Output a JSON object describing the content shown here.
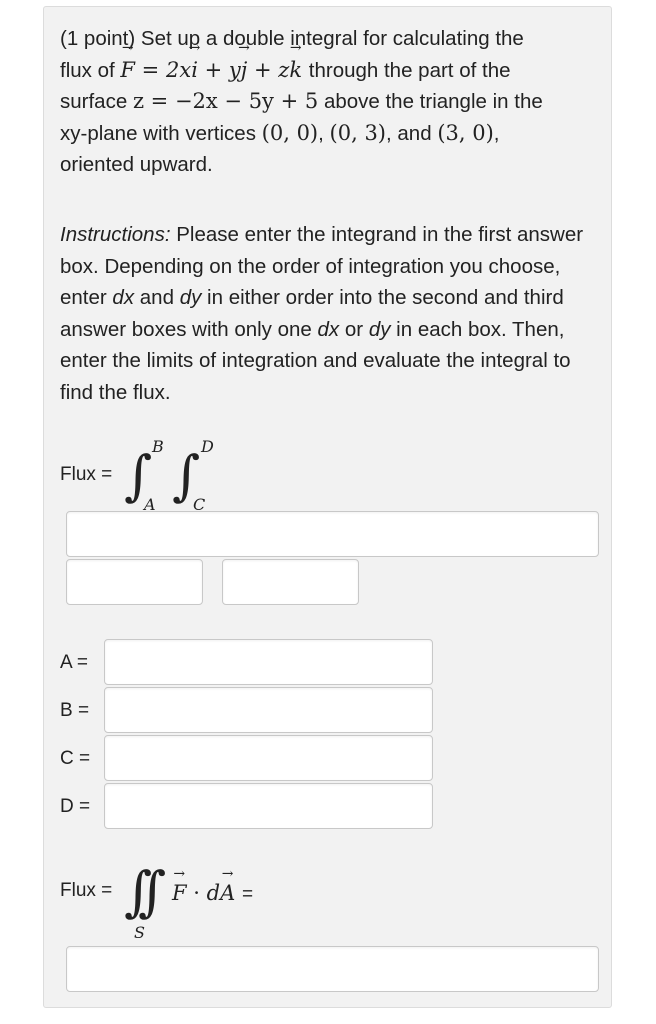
{
  "problem": {
    "line1": "(1 point) Set up a double integral for calculating the",
    "flux_of": "flux of",
    "F": "F",
    "eq": "=",
    "term1": "2x",
    "i": "i",
    "plus1": "+",
    "term2": "y",
    "j": "j",
    "plus2": "+",
    "term3": "z",
    "k": "k",
    "through": "through the part of the",
    "surface": "surface",
    "surface_eq": "z = −2x − 5y + 5",
    "above": "above the triangle in the",
    "vertices_prefix": "xy-plane with vertices",
    "v1": "(0, 0)",
    "sep1": ",",
    "v2": "(0, 3)",
    "sep2": ", and",
    "v3": "(3, 0)",
    "sep3": ",",
    "line5": "oriented upward."
  },
  "instructions": {
    "label": "Instructions:",
    "text_1": " Please enter the integrand in the first answer box. Depending on the order of integration you choose, enter ",
    "dx1": "dx",
    "and": " and ",
    "dy1": "dy",
    "text_2": " in either order into the second and third answer boxes with only one ",
    "dx2": "dx",
    "or": " or ",
    "dy2": "dy",
    "text_3": " in each box. Then, enter the limits of integration and evaluate the integral to find the flux."
  },
  "flux_setup": {
    "label": "Flux =",
    "upper_outer": "B",
    "lower_outer": "A",
    "upper_inner": "D",
    "lower_inner": "C"
  },
  "limits": {
    "a_label": "A =",
    "b_label": "B =",
    "c_label": "C =",
    "d_label": "D ="
  },
  "flux_eval": {
    "label": "Flux =",
    "region": "S",
    "F": "F",
    "dot": "·",
    "d": "d",
    "A": "A",
    "eq": "="
  }
}
